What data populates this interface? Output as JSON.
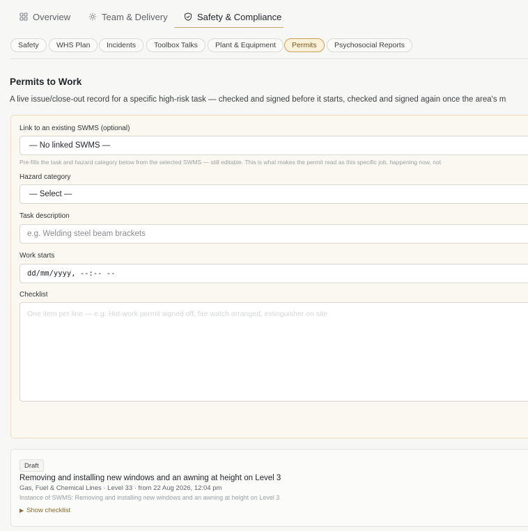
{
  "tabs": [
    {
      "label": "Overview",
      "icon": "grid-icon"
    },
    {
      "label": "Team & Delivery",
      "icon": "gear-icon"
    },
    {
      "label": "Safety & Compliance",
      "icon": "shield-icon",
      "active": true
    }
  ],
  "subtabs": [
    "Safety",
    "WHS Plan",
    "Incidents",
    "Toolbox Talks",
    "Plant & Equipment",
    "Permits",
    "Psychosocial Reports"
  ],
  "active_subtab": "Permits",
  "colors": {
    "accent": "#c9a96a",
    "pill_active_bg": "#fbf0d8",
    "form_bg": "#fbf8f1"
  },
  "section": {
    "title": "Permits to Work",
    "description": "A live issue/close-out record for a specific high-risk task — checked and signed before it starts, checked and signed again once the area's m"
  },
  "form": {
    "swms_label": "Link to an existing SWMS (optional)",
    "swms_value": "— No linked SWMS —",
    "swms_hint": "Pre-fills the task and hazard category below from the selected SWMS — still editable. This is what makes the permit read as this specific job, happening now, not",
    "hazard_label": "Hazard category",
    "hazard_value": "— Select —",
    "task_label": "Task description",
    "task_placeholder": "e.g. Welding steel beam brackets",
    "work_label": "Work starts",
    "work_value": "dd/mm/yyyy, --:-- --",
    "checklist_label": "Checklist",
    "checklist_placeholder": "One item per line — e.g. Hot-work permit signed off, fire watch arranged, extinguisher on site"
  },
  "permit": {
    "status": "Draft",
    "title": "Removing and installing new windows and an awning at height on Level 3",
    "meta": "Gas, Fuel & Chemical Lines · Level 33 · from 22 Aug 2026, 12:04 pm",
    "instance": "Instance of SWMS: Removing and installing new windows and an awning at height on Level 3",
    "toggle": "Show checklist"
  }
}
